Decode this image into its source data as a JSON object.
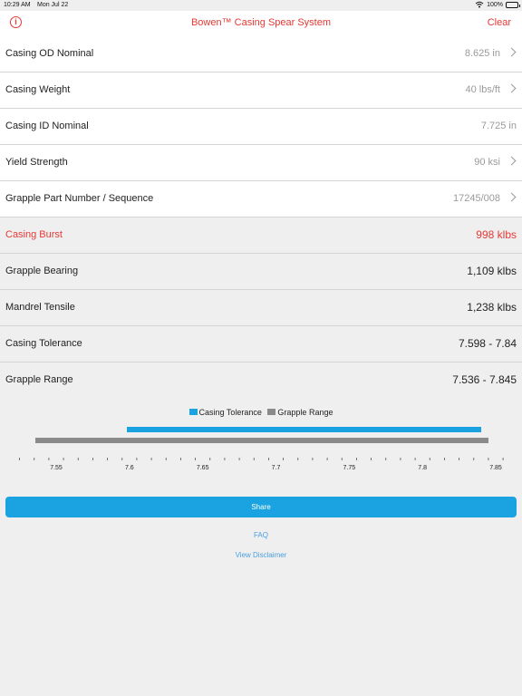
{
  "status": {
    "time": "10:29 AM",
    "date": "Mon Jul 22",
    "battery": "100%"
  },
  "nav": {
    "title": "Bowen™ Casing Spear System",
    "clear_label": "Clear",
    "info_icon": "i"
  },
  "inputs": [
    {
      "label": "Casing OD Nominal",
      "value": "8.625 in",
      "chevron": true
    },
    {
      "label": "Casing Weight",
      "value": "40 lbs/ft",
      "chevron": true
    },
    {
      "label": "Casing ID Nominal",
      "value": "7.725 in",
      "chevron": false
    },
    {
      "label": "Yield Strength",
      "value": "90 ksi",
      "chevron": true
    },
    {
      "label": "Grapple Part Number / Sequence",
      "value": "17245/008",
      "chevron": true
    }
  ],
  "results": [
    {
      "label": "Casing Burst",
      "value": "998 klbs",
      "highlight": true
    },
    {
      "label": "Grapple Bearing",
      "value": "1,109 klbs",
      "highlight": false
    },
    {
      "label": "Mandrel Tensile",
      "value": "1,238 klbs",
      "highlight": false
    },
    {
      "label": "Casing Tolerance",
      "value": "7.598 - 7.84",
      "highlight": false
    },
    {
      "label": "Grapple Range",
      "value": "7.536 - 7.845",
      "highlight": false
    }
  ],
  "chart_data": {
    "type": "bar",
    "orientation": "horizontal-range",
    "series": [
      {
        "name": "Casing Tolerance",
        "color": "#1aa3e0",
        "range": [
          7.598,
          7.84
        ]
      },
      {
        "name": "Grapple Range",
        "color": "#8a8a8a",
        "range": [
          7.536,
          7.845
        ]
      }
    ],
    "xlim": [
      7.52,
      7.86
    ],
    "ticks": [
      "7.55",
      "7.6",
      "7.65",
      "7.7",
      "7.75",
      "7.8",
      "7.85"
    ],
    "minor_tick_step": 0.01
  },
  "actions": {
    "share_label": "Share",
    "faq_label": "FAQ",
    "disclaimer_label": "View Disclaimer"
  }
}
